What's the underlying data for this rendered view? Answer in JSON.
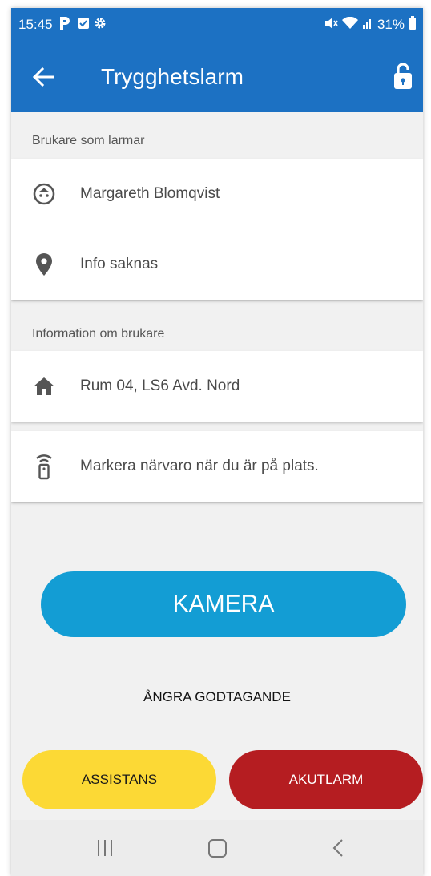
{
  "status_bar": {
    "time": "15:45",
    "battery": "31%",
    "left_icons": [
      "p-icon",
      "check-box-icon",
      "gear-icon"
    ],
    "right_icons": [
      "mute-icon",
      "wifi-icon",
      "signal-icon",
      "battery-icon"
    ]
  },
  "app_bar": {
    "title": "Trygghetslarm",
    "back_icon": "arrow-left-icon",
    "lock_icon": "unlocked-padlock-icon"
  },
  "section_alarming_user": {
    "label": "Brukare som larmar",
    "rows": [
      {
        "icon": "face-icon",
        "text": "Margareth Blomqvist"
      },
      {
        "icon": "location-pin-icon",
        "text": "Info saknas"
      }
    ]
  },
  "section_user_info": {
    "label": "Information om brukare",
    "rows": [
      {
        "icon": "home-icon",
        "text": "Rum 04, LS6 Avd. Nord"
      }
    ]
  },
  "presence_row": {
    "icon": "remote-signal-icon",
    "text": "Markera närvaro när du är på plats."
  },
  "buttons": {
    "camera": "KAMERA",
    "undo_accept": "ÅNGRA GODTAGANDE",
    "assistance": "ASSISTANS",
    "emergency": "AKUTLARM"
  },
  "colors": {
    "primary": "#1c71c3",
    "camera": "#139dd4",
    "assistance": "#fcd935",
    "emergency": "#b51d21"
  },
  "nav_bar": [
    "recent-apps-icon",
    "home-square-icon",
    "back-chevron-icon"
  ]
}
